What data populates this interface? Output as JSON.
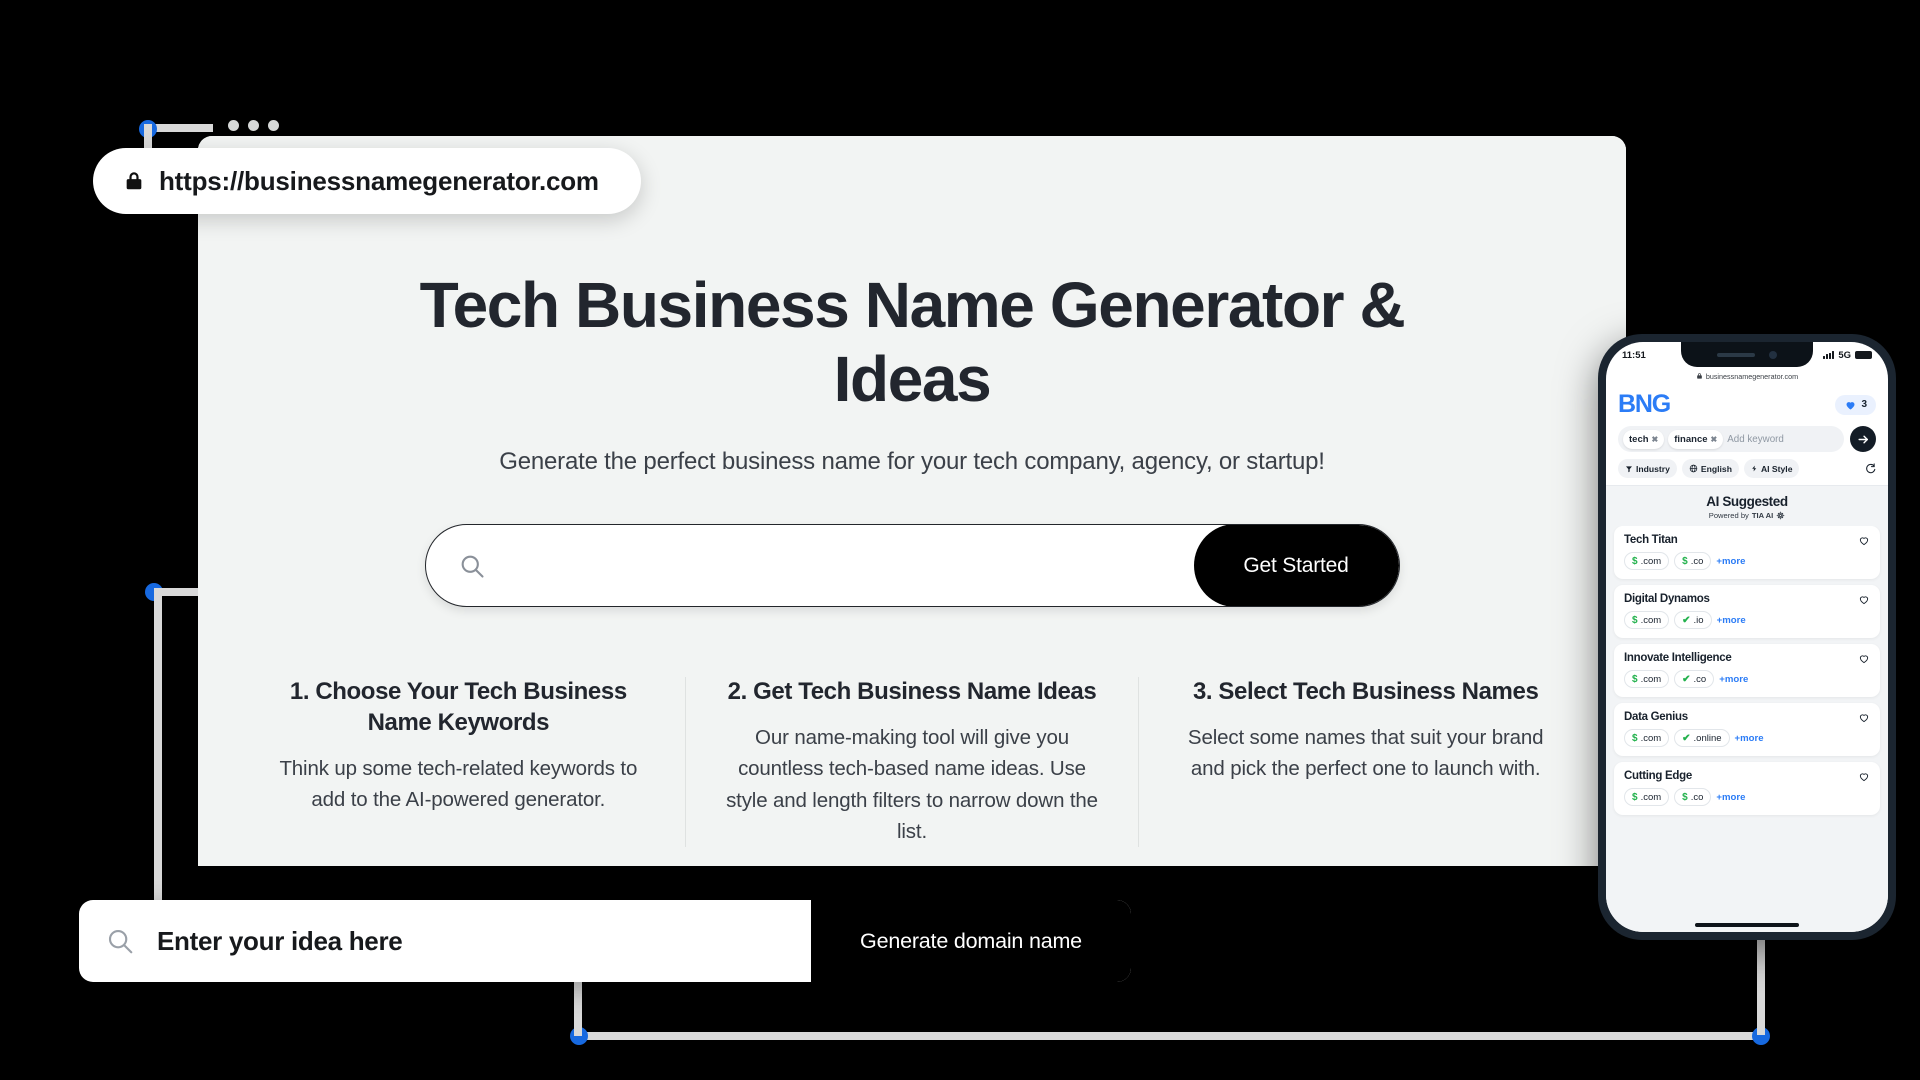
{
  "browser": {
    "url": "https://businessnamegenerator.com",
    "lock_icon": "lock-icon",
    "window_dots": "window-dots"
  },
  "hero": {
    "title": "Tech Business Name Generator & Ideas",
    "subtitle": "Generate the perfect business name for your tech company, agency, or startup!",
    "search_placeholder": "",
    "search_value": "",
    "search_icon": "search-icon",
    "cta_label": "Get Started"
  },
  "steps": [
    {
      "heading": "1. Choose Your Tech Business Name Keywords",
      "body": "Think up some tech-related keywords to add to the AI-powered generator."
    },
    {
      "heading": "2. Get Tech Business Name Ideas",
      "body": "Our name-making tool will give you countless tech-based name ideas. Use style and length filters to narrow down the list."
    },
    {
      "heading": "3. Select Tech Business Names",
      "body": "Select some names that suit your brand and pick the perfect one to launch with."
    }
  ],
  "bottom_bar": {
    "search_icon": "search-icon",
    "value": "Enter your idea here",
    "button_label": "Generate domain name"
  },
  "phone": {
    "status": {
      "time": "11:51",
      "network": "5G",
      "signal_icon": "signal-bars-icon",
      "battery_icon": "battery-icon"
    },
    "browser_url": "businessnamegenerator.com",
    "lock_icon": "lock-icon",
    "logo": "BNG",
    "favorites": {
      "heart_icon": "heart-filled-icon",
      "count": "3"
    },
    "keywords": [
      "tech",
      "finance"
    ],
    "keyword_placeholder": "Add keyword",
    "submit_icon": "arrow-right-icon",
    "filters": [
      {
        "icon": "filter-icon",
        "label": "Industry"
      },
      {
        "icon": "globe-icon",
        "label": "English"
      },
      {
        "icon": "bolt-icon",
        "label": "AI Style"
      }
    ],
    "refresh_icon": "refresh-icon",
    "section_title": "AI Suggested",
    "section_sub_prefix": "Powered by ",
    "section_sub_brand": "TIA AI",
    "section_sub_icon": "chip-icon",
    "results": [
      {
        "name": "Tech Titan",
        "domains": [
          {
            "sig": "$",
            "tld": ".com"
          },
          {
            "sig": "$",
            "tld": ".co"
          }
        ],
        "more": "+more",
        "fav_icon": "heart-outline-icon"
      },
      {
        "name": "Digital Dynamos",
        "domains": [
          {
            "sig": "$",
            "tld": ".com"
          },
          {
            "sig": "✔",
            "tld": ".io"
          }
        ],
        "more": "+more",
        "fav_icon": "heart-outline-icon"
      },
      {
        "name": "Innovate Intelligence",
        "domains": [
          {
            "sig": "$",
            "tld": ".com"
          },
          {
            "sig": "✔",
            "tld": ".co"
          }
        ],
        "more": "+more",
        "fav_icon": "heart-outline-icon"
      },
      {
        "name": "Data Genius",
        "domains": [
          {
            "sig": "$",
            "tld": ".com"
          },
          {
            "sig": "✔",
            "tld": ".online"
          }
        ],
        "more": "+more",
        "fav_icon": "heart-outline-icon"
      },
      {
        "name": "Cutting Edge",
        "domains": [
          {
            "sig": "$",
            "tld": ".com"
          },
          {
            "sig": "$",
            "tld": ".co"
          }
        ],
        "more": "+more",
        "fav_icon": "heart-outline-icon"
      }
    ]
  },
  "colors": {
    "background": "#000000",
    "card": "#f2f4f3",
    "accent_blue": "#1769E0",
    "logo_blue": "#2b7cf6",
    "text_dark": "#22262e",
    "green": "#22b14c"
  }
}
